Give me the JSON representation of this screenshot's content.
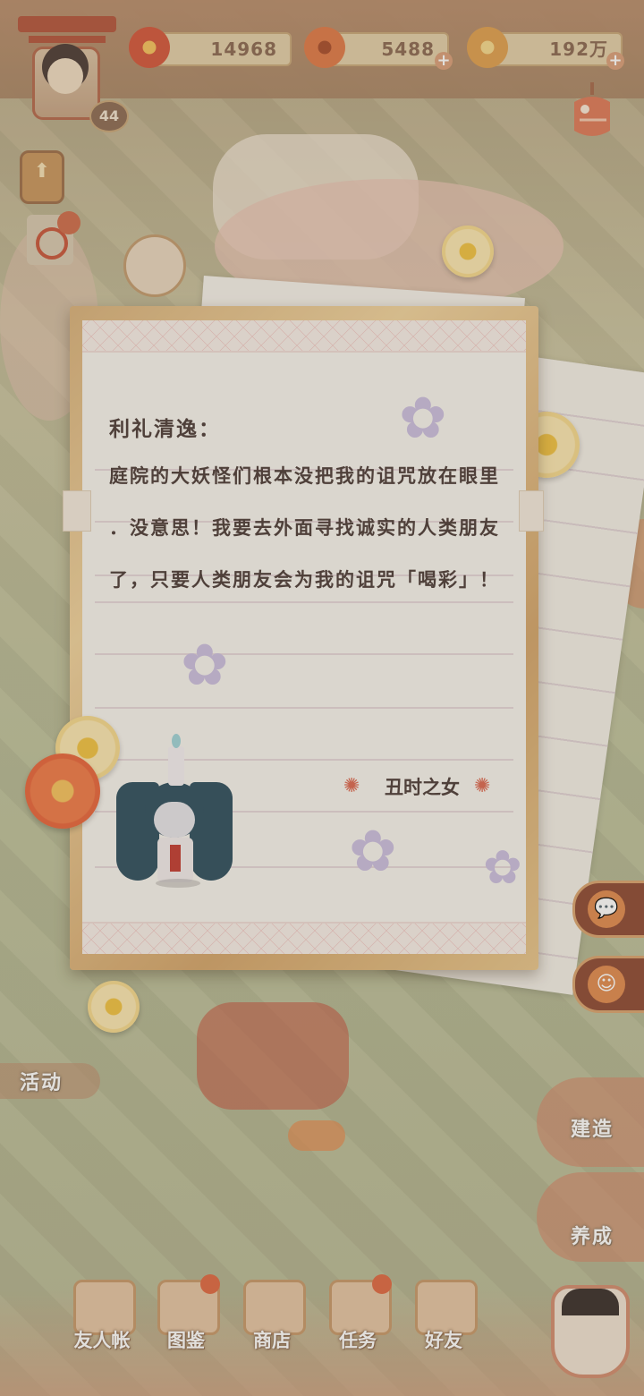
{
  "top_bar": {
    "player_level": "44",
    "resources": [
      {
        "name": "flower-currency",
        "value": "14968",
        "icon": "red-flower-icon",
        "color": "#d4573c"
      },
      {
        "name": "magatama",
        "value": "5488",
        "icon": "magatama-icon",
        "color": "#e07a49"
      },
      {
        "name": "coins",
        "value": "192万",
        "icon": "coin-icon",
        "color": "#e0a050"
      }
    ],
    "plus_symbol": "+"
  },
  "letter": {
    "greeting": "利礼清逸：",
    "lines": [
      "庭院的大妖怪们根本没把我的诅咒放在眼里",
      "．没意思！我要去外面寻找诚实的人类朋友",
      "了，只要人类朋友会为我的诅咒「喝彩」！"
    ],
    "signature": "丑时之女",
    "signature_deco": "✺",
    "character": "ushi-no-toki-mairi"
  },
  "side_buttons": [
    {
      "name": "chat",
      "icon": "chat-bubble-icon",
      "glyph": "💬"
    },
    {
      "name": "shikigami",
      "icon": "shikigami-icon",
      "glyph": "☺"
    }
  ],
  "scene_labels": {
    "activity": "活动",
    "build": "建造",
    "nurture": "养成"
  },
  "bottom_nav": [
    {
      "label": "友人帐",
      "icon": "friend-book-icon",
      "badge": false
    },
    {
      "label": "图鉴",
      "icon": "codex-icon",
      "badge": true
    },
    {
      "label": "商店",
      "icon": "shop-cat-icon",
      "badge": false
    },
    {
      "label": "任务",
      "icon": "task-icon",
      "badge": true
    },
    {
      "label": "好友",
      "icon": "friends-icon",
      "badge": false
    }
  ],
  "colors": {
    "accent": "#d9a470",
    "text_dark": "#4d3e3a",
    "sakura": "#cbbfe0"
  }
}
